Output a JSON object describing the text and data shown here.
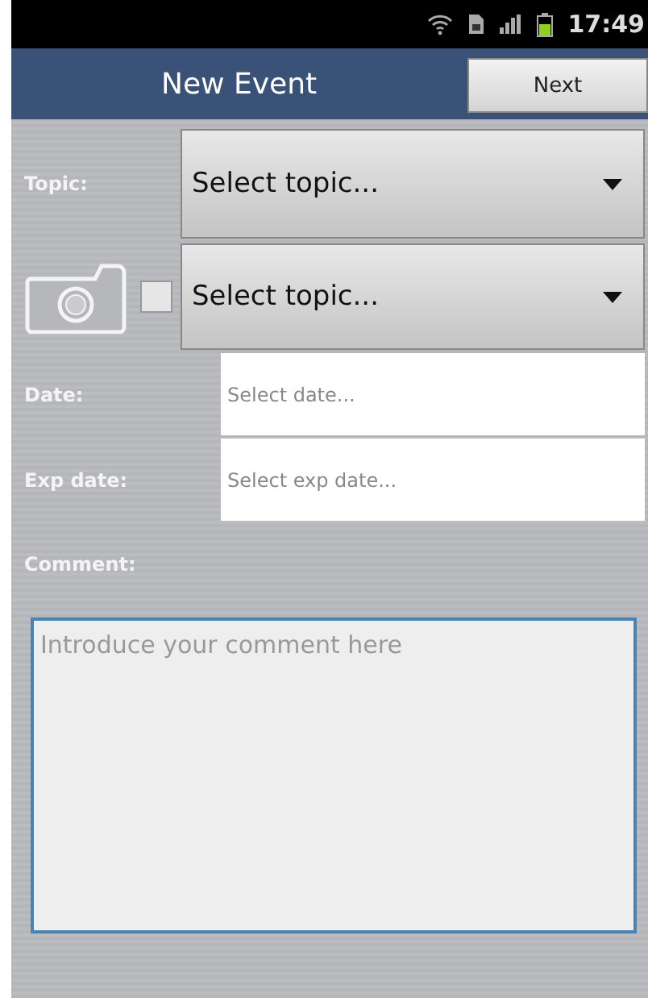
{
  "status_bar": {
    "time": "17:49"
  },
  "header": {
    "title": "New Event",
    "next_button": "Next"
  },
  "topic": {
    "label": "Topic:",
    "value": "Select topic..."
  },
  "photo_row": {
    "checked": false,
    "value": "Select topic..."
  },
  "date": {
    "label": "Date:",
    "placeholder": "Select date..."
  },
  "exp_date": {
    "label": "Exp date:",
    "placeholder": "Select exp date..."
  },
  "comment": {
    "label": "Comment:",
    "placeholder": "Introduce your comment here"
  }
}
